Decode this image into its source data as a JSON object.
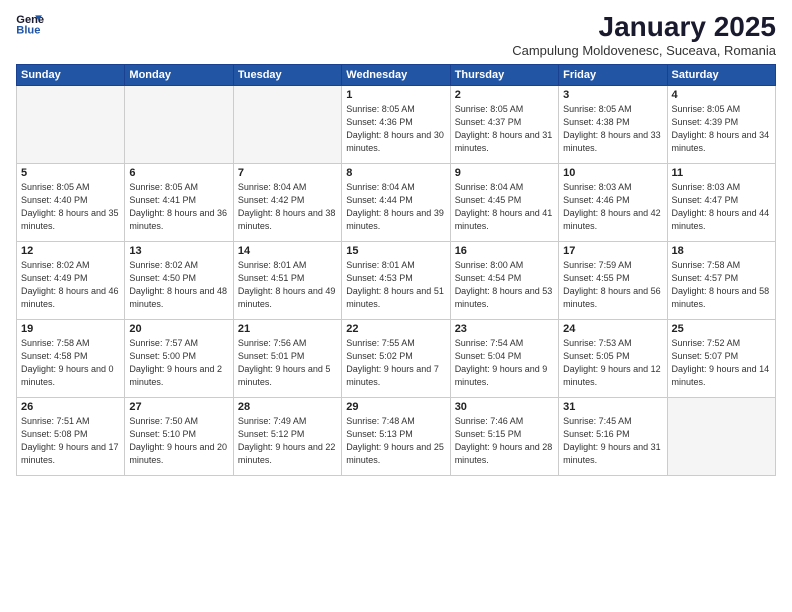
{
  "logo": {
    "line1": "General",
    "line2": "Blue"
  },
  "title": "January 2025",
  "subtitle": "Campulung Moldovenesc, Suceava, Romania",
  "weekdays": [
    "Sunday",
    "Monday",
    "Tuesday",
    "Wednesday",
    "Thursday",
    "Friday",
    "Saturday"
  ],
  "weeks": [
    [
      {
        "day": "",
        "info": ""
      },
      {
        "day": "",
        "info": ""
      },
      {
        "day": "",
        "info": ""
      },
      {
        "day": "1",
        "info": "Sunrise: 8:05 AM\nSunset: 4:36 PM\nDaylight: 8 hours\nand 30 minutes."
      },
      {
        "day": "2",
        "info": "Sunrise: 8:05 AM\nSunset: 4:37 PM\nDaylight: 8 hours\nand 31 minutes."
      },
      {
        "day": "3",
        "info": "Sunrise: 8:05 AM\nSunset: 4:38 PM\nDaylight: 8 hours\nand 33 minutes."
      },
      {
        "day": "4",
        "info": "Sunrise: 8:05 AM\nSunset: 4:39 PM\nDaylight: 8 hours\nand 34 minutes."
      }
    ],
    [
      {
        "day": "5",
        "info": "Sunrise: 8:05 AM\nSunset: 4:40 PM\nDaylight: 8 hours\nand 35 minutes."
      },
      {
        "day": "6",
        "info": "Sunrise: 8:05 AM\nSunset: 4:41 PM\nDaylight: 8 hours\nand 36 minutes."
      },
      {
        "day": "7",
        "info": "Sunrise: 8:04 AM\nSunset: 4:42 PM\nDaylight: 8 hours\nand 38 minutes."
      },
      {
        "day": "8",
        "info": "Sunrise: 8:04 AM\nSunset: 4:44 PM\nDaylight: 8 hours\nand 39 minutes."
      },
      {
        "day": "9",
        "info": "Sunrise: 8:04 AM\nSunset: 4:45 PM\nDaylight: 8 hours\nand 41 minutes."
      },
      {
        "day": "10",
        "info": "Sunrise: 8:03 AM\nSunset: 4:46 PM\nDaylight: 8 hours\nand 42 minutes."
      },
      {
        "day": "11",
        "info": "Sunrise: 8:03 AM\nSunset: 4:47 PM\nDaylight: 8 hours\nand 44 minutes."
      }
    ],
    [
      {
        "day": "12",
        "info": "Sunrise: 8:02 AM\nSunset: 4:49 PM\nDaylight: 8 hours\nand 46 minutes."
      },
      {
        "day": "13",
        "info": "Sunrise: 8:02 AM\nSunset: 4:50 PM\nDaylight: 8 hours\nand 48 minutes."
      },
      {
        "day": "14",
        "info": "Sunrise: 8:01 AM\nSunset: 4:51 PM\nDaylight: 8 hours\nand 49 minutes."
      },
      {
        "day": "15",
        "info": "Sunrise: 8:01 AM\nSunset: 4:53 PM\nDaylight: 8 hours\nand 51 minutes."
      },
      {
        "day": "16",
        "info": "Sunrise: 8:00 AM\nSunset: 4:54 PM\nDaylight: 8 hours\nand 53 minutes."
      },
      {
        "day": "17",
        "info": "Sunrise: 7:59 AM\nSunset: 4:55 PM\nDaylight: 8 hours\nand 56 minutes."
      },
      {
        "day": "18",
        "info": "Sunrise: 7:58 AM\nSunset: 4:57 PM\nDaylight: 8 hours\nand 58 minutes."
      }
    ],
    [
      {
        "day": "19",
        "info": "Sunrise: 7:58 AM\nSunset: 4:58 PM\nDaylight: 9 hours\nand 0 minutes."
      },
      {
        "day": "20",
        "info": "Sunrise: 7:57 AM\nSunset: 5:00 PM\nDaylight: 9 hours\nand 2 minutes."
      },
      {
        "day": "21",
        "info": "Sunrise: 7:56 AM\nSunset: 5:01 PM\nDaylight: 9 hours\nand 5 minutes."
      },
      {
        "day": "22",
        "info": "Sunrise: 7:55 AM\nSunset: 5:02 PM\nDaylight: 9 hours\nand 7 minutes."
      },
      {
        "day": "23",
        "info": "Sunrise: 7:54 AM\nSunset: 5:04 PM\nDaylight: 9 hours\nand 9 minutes."
      },
      {
        "day": "24",
        "info": "Sunrise: 7:53 AM\nSunset: 5:05 PM\nDaylight: 9 hours\nand 12 minutes."
      },
      {
        "day": "25",
        "info": "Sunrise: 7:52 AM\nSunset: 5:07 PM\nDaylight: 9 hours\nand 14 minutes."
      }
    ],
    [
      {
        "day": "26",
        "info": "Sunrise: 7:51 AM\nSunset: 5:08 PM\nDaylight: 9 hours\nand 17 minutes."
      },
      {
        "day": "27",
        "info": "Sunrise: 7:50 AM\nSunset: 5:10 PM\nDaylight: 9 hours\nand 20 minutes."
      },
      {
        "day": "28",
        "info": "Sunrise: 7:49 AM\nSunset: 5:12 PM\nDaylight: 9 hours\nand 22 minutes."
      },
      {
        "day": "29",
        "info": "Sunrise: 7:48 AM\nSunset: 5:13 PM\nDaylight: 9 hours\nand 25 minutes."
      },
      {
        "day": "30",
        "info": "Sunrise: 7:46 AM\nSunset: 5:15 PM\nDaylight: 9 hours\nand 28 minutes."
      },
      {
        "day": "31",
        "info": "Sunrise: 7:45 AM\nSunset: 5:16 PM\nDaylight: 9 hours\nand 31 minutes."
      },
      {
        "day": "",
        "info": ""
      }
    ]
  ]
}
